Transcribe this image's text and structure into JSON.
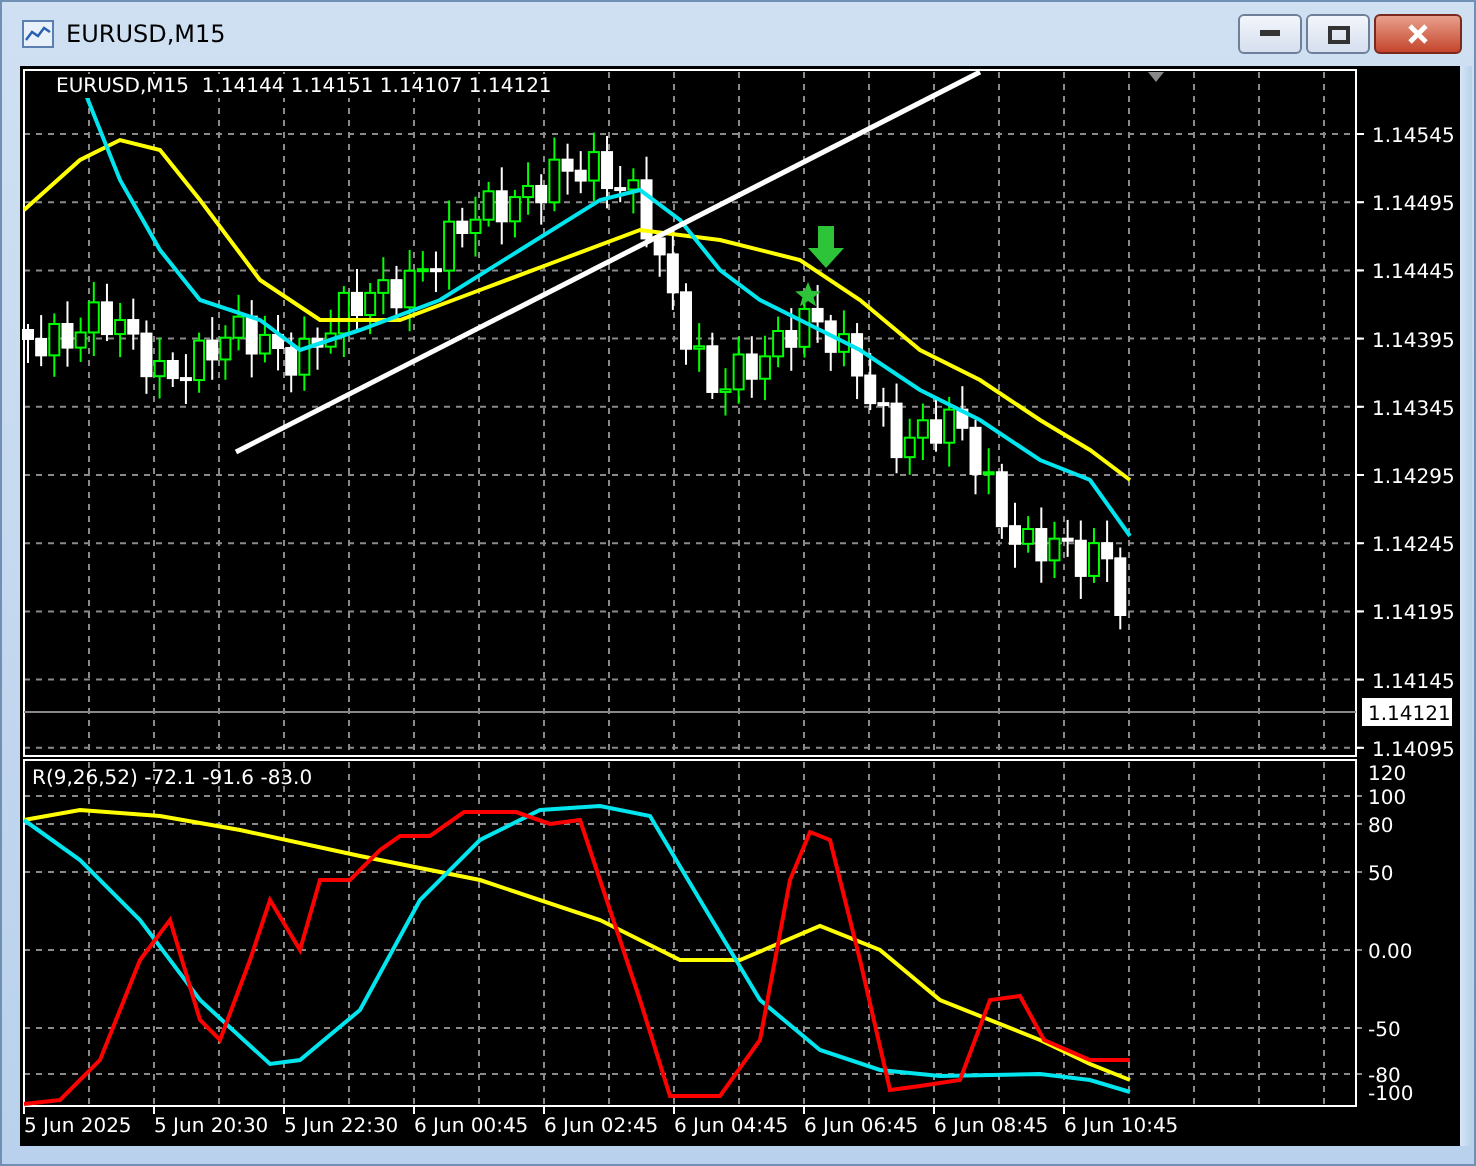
{
  "window": {
    "title": "EURUSD,M15"
  },
  "chart_header": "EURUSD,M15  1.14144 1.14151 1.14107 1.14121",
  "price_axis": [
    "1.14545",
    "1.14495",
    "1.14445",
    "1.14395",
    "1.14345",
    "1.14295",
    "1.14245",
    "1.14195",
    "1.14145",
    "1.14095"
  ],
  "current_price": "1.14121",
  "indicator": {
    "label": "R(9,26,52) -72.1 -91.6 -83.0",
    "axis": [
      "120",
      "100",
      "80",
      "50",
      "0.00",
      "-50",
      "-80",
      "-100"
    ]
  },
  "time_axis": [
    "5 Jun 2025",
    "5 Jun 20:30",
    "5 Jun 22:30",
    "6 Jun 00:45",
    "6 Jun 02:45",
    "6 Jun 04:45",
    "6 Jun 06:45",
    "6 Jun 08:45",
    "6 Jun 10:45"
  ]
}
